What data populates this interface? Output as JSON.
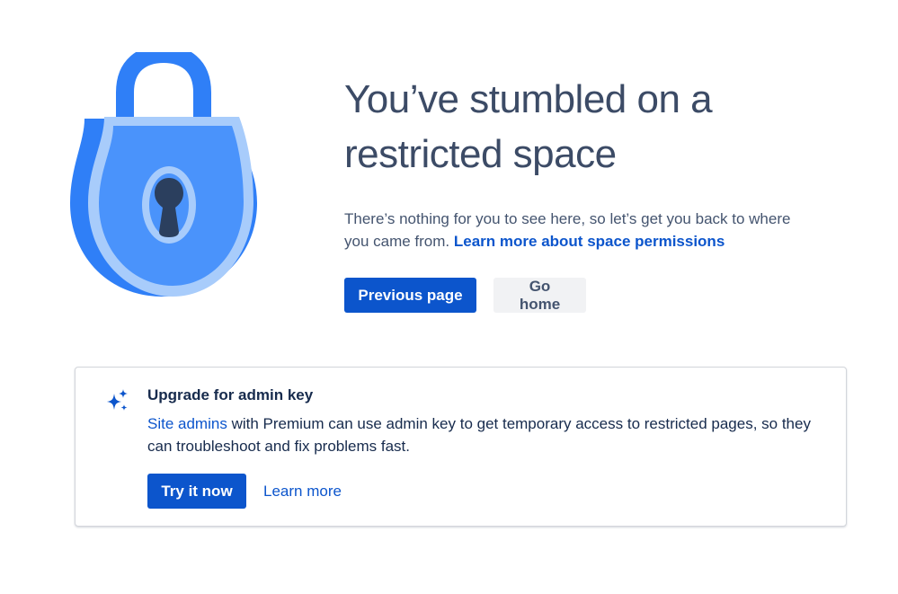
{
  "hero": {
    "headline": "You’ve stumbled on a restricted space",
    "description": "There’s nothing for you to see here, so let’s get you back to where you came from.",
    "permissions_link": "Learn more about space permissions",
    "previous_button": "Previous page",
    "home_button": "Go home"
  },
  "upgrade_card": {
    "title": "Upgrade for admin key",
    "admins_link": "Site admins",
    "text": "with Premium can use admin key to get temporary access to restricted pages, so they can troubleshoot and fix problems fast.",
    "try_button": "Try it now",
    "learn_more_link": "Learn more"
  },
  "icons": {
    "illustration": "padlock-icon",
    "card_icon": "sparkle-icon"
  },
  "colors": {
    "brand_blue": "#0c55cc",
    "heading": "#3c4b66",
    "lock_dark": "#2f7ff7",
    "lock_mid": "#4a93fb",
    "lock_light": "#a8ccfb",
    "keyhole": "#2b3f5e"
  }
}
